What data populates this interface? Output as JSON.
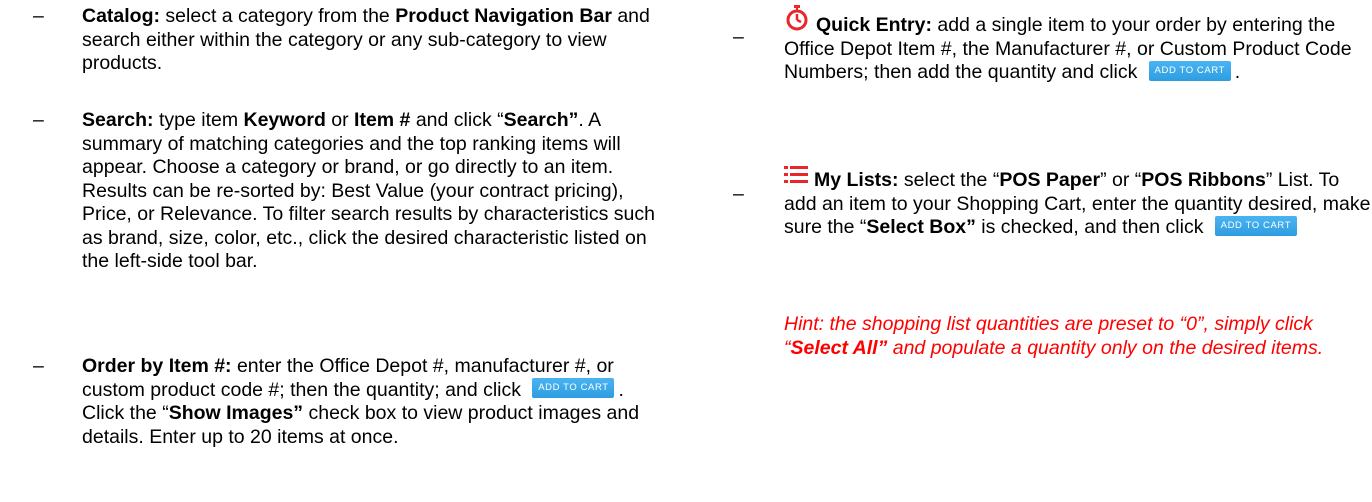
{
  "dash": "–",
  "left": {
    "catalog": {
      "title": "Catalog:",
      "t1": " select a category from the ",
      "bold1": "Product Navigation Bar",
      "t2": " and search either within the category or any sub-category to view products."
    },
    "search": {
      "title": "Search:",
      "t1": " type item ",
      "bold1": "Keyword",
      "t2": " or ",
      "bold2": "Item #",
      "t3": " and click “",
      "bold3": "Search”",
      "t4": ". A summary of matching categories and the top ranking items will appear. Choose a category or brand, or go directly to an item. Results can be re-sorted by: Best Value (your contract pricing), Price, or Relevance. To filter search results by characteristics such as brand, size, color, etc., click the desired characteristic listed on the left-side tool bar."
    },
    "order": {
      "title": "Order by Item #:",
      "t1": " enter the Office Depot #, manufacturer #, or custom product code #; then the quantity; and click ",
      "button": "ADD TO CART",
      "t2": ". Click the “",
      "bold1": "Show Images”",
      "t3": " check box to view product images and details. Enter up to 20 items at once."
    }
  },
  "right": {
    "quick": {
      "icon": "stopwatch-icon",
      "title": "Quick Entry:",
      "t1": " add a single item to your order by entering the Office Depot Item #, the Manufacturer #, or Custom Product Code Numbers; then add the quantity and click ",
      "button": "ADD TO CART",
      "t2": "."
    },
    "lists": {
      "icon": "list-icon",
      "title": "My Lists:",
      "t1": " select the “",
      "bold1": "POS Paper",
      "t2": "” or “",
      "bold2": "POS Ribbons",
      "t3": "” List. To add an item to your Shopping Cart, enter the quantity desired, make sure the “",
      "bold3": "Select Box”",
      "t4": " is checked, and then click ",
      "button": "ADD TO CART"
    },
    "hint": {
      "t1": "Hint: the shopping list quantities are preset to “0”, simply click “",
      "bold1": "Select All”",
      "t2": " and populate a quantity only on the desired items."
    }
  },
  "colors": {
    "button": "#2e9de0",
    "hint": "#ff0000",
    "icon": "#e8262b"
  }
}
